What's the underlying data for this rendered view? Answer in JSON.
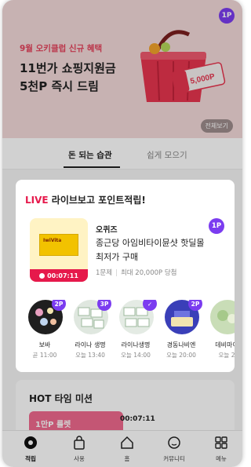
{
  "banner": {
    "badge": "1P",
    "subtitle": "9월 오키클럽 신규 혜택",
    "title_line1": "11번가 쇼핑지원금",
    "title_line2": "5천P 즉시 드림",
    "coupon_text": "5,000P",
    "view_all": "전체보기"
  },
  "tabs": [
    {
      "label": "돈 되는 습관"
    },
    {
      "label": "쉽게 모으기"
    }
  ],
  "live": {
    "title_prefix": "LIVE",
    "title_rest": "라이브보고 포인트적립!",
    "product": {
      "box_label": "IwiVita",
      "timer": "00:07:11",
      "brand": "오퀴즈",
      "title": "종근당 아임비타이뮨샷 핫딜몰 최저가 구매",
      "meta_a": "1문제",
      "meta_b": "최대 20,000P 당첨",
      "badge": "1P"
    },
    "thumbs": [
      {
        "name": "보바",
        "time": "곧 11:00",
        "badge": "2P",
        "bg": "#1f1f1f"
      },
      {
        "name": "라이나 생명",
        "time": "오늘 13:40",
        "badge": "3P",
        "bg": "#dfe7df"
      },
      {
        "name": "라이나생명",
        "time": "오늘 14:00",
        "badge": "✓",
        "bg": "#e4ebe4"
      },
      {
        "name": "경동나비엔",
        "time": "오늘 20:00",
        "badge": "2P",
        "bg": "#3a3fb8"
      },
      {
        "name": "데비마이",
        "time": "오늘 2",
        "badge": "",
        "bg": "#c9ddb7"
      }
    ]
  },
  "hot": {
    "title": "HOT 타임 미션",
    "image_text": "1만P 룰렛",
    "timer": "00:07:11"
  },
  "nav": [
    {
      "label": "적립",
      "icon": "earn-icon"
    },
    {
      "label": "사용",
      "icon": "shopping-bag-icon"
    },
    {
      "label": "홈",
      "icon": "home-icon"
    },
    {
      "label": "커뮤니티",
      "icon": "chat-icon"
    },
    {
      "label": "메뉴",
      "icon": "grid-icon"
    }
  ]
}
